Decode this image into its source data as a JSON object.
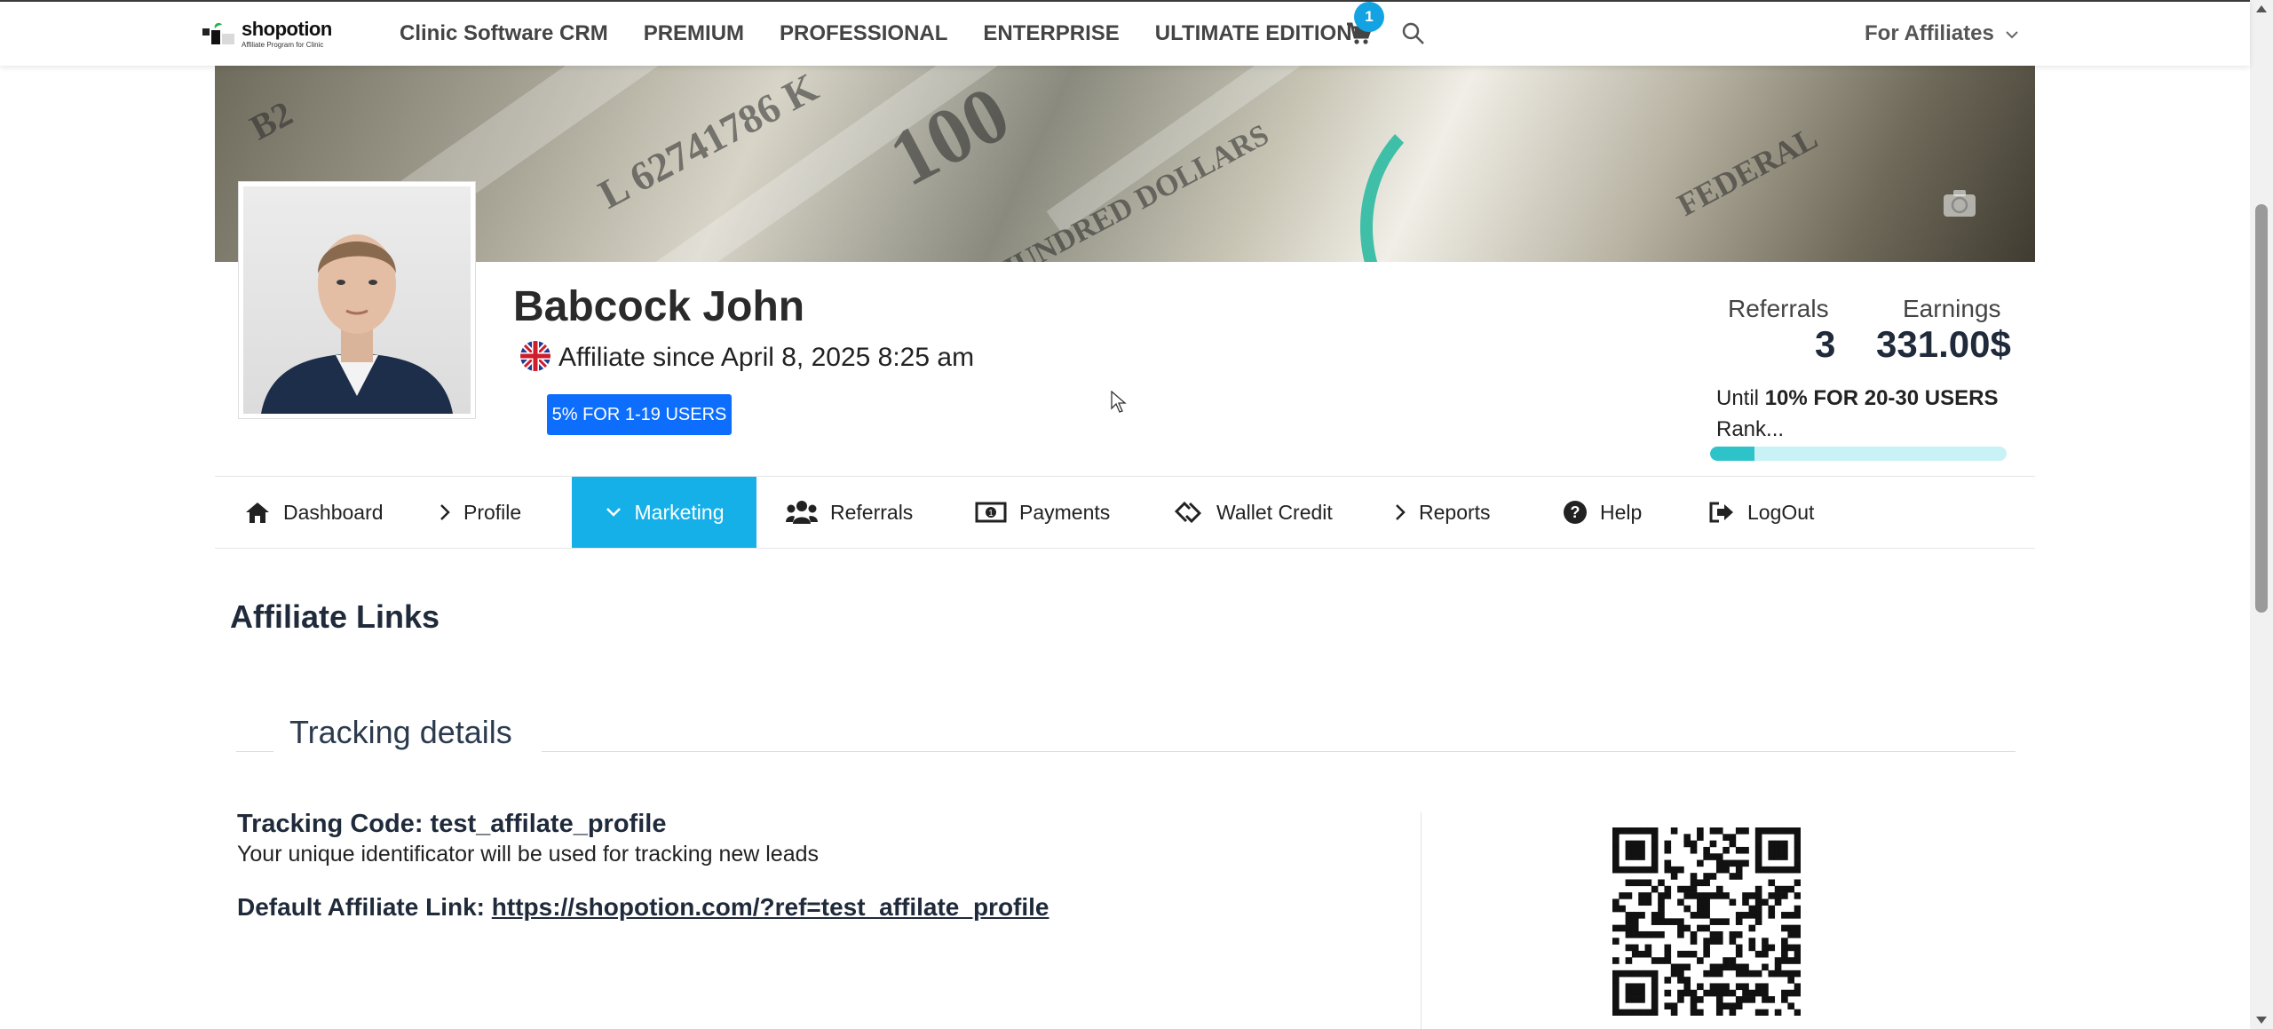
{
  "header": {
    "logo": {
      "brand": "shopotion",
      "tagline": "Affiliate Program for Clinic"
    },
    "nav": [
      "Clinic Software CRM",
      "PREMIUM",
      "PROFESSIONAL",
      "ENTERPRISE",
      "ULTIMATE EDITION"
    ],
    "cart_count": "1",
    "affiliates_menu": "For Affiliates"
  },
  "profile": {
    "name": "Babcock John",
    "since": "Affiliate since April 8, 2025 8:25 am",
    "level_badge": "5% FOR 1-19 USERS",
    "flag": "uk-flag-icon"
  },
  "stats": {
    "referrals_label": "Referrals",
    "referrals_value": "3",
    "earnings_label": "Earnings",
    "earnings_value": "331.00$",
    "until_prefix": "Until",
    "until_target": "10% FOR 20-30 USERS",
    "rank_label": "Rank...",
    "rank_progress": 0.15
  },
  "tabs": [
    {
      "label": "Dashboard",
      "icon": "home-icon"
    },
    {
      "label": "Profile",
      "icon": "chevron-right-icon"
    },
    {
      "label": "Marketing",
      "icon": "chevron-down-icon",
      "active": true
    },
    {
      "label": "Referrals",
      "icon": "users-icon"
    },
    {
      "label": "Payments",
      "icon": "money-icon"
    },
    {
      "label": "Wallet Credit",
      "icon": "wallet-icon"
    },
    {
      "label": "Reports",
      "icon": "chevron-right-icon"
    },
    {
      "label": "Help",
      "icon": "help-icon"
    },
    {
      "label": "LogOut",
      "icon": "logout-icon"
    }
  ],
  "content": {
    "section_title": "Affiliate Links",
    "fieldset_legend": "Tracking details",
    "tracking_code_label": "Tracking Code: test_affilate_profile",
    "tracking_code_hint": "Your unique identificator will be used for tracking new leads",
    "default_link_label": "Default Affiliate Link:",
    "default_link_url": "https://shopotion.com/?ref=test_affilate_profile"
  },
  "colors": {
    "accent": "#16b0e8",
    "badge_blue": "#0d6efd",
    "cart_badge": "#14a3e2",
    "rank_fill": "#2ec3c9",
    "rank_track": "#c9f2f6"
  }
}
